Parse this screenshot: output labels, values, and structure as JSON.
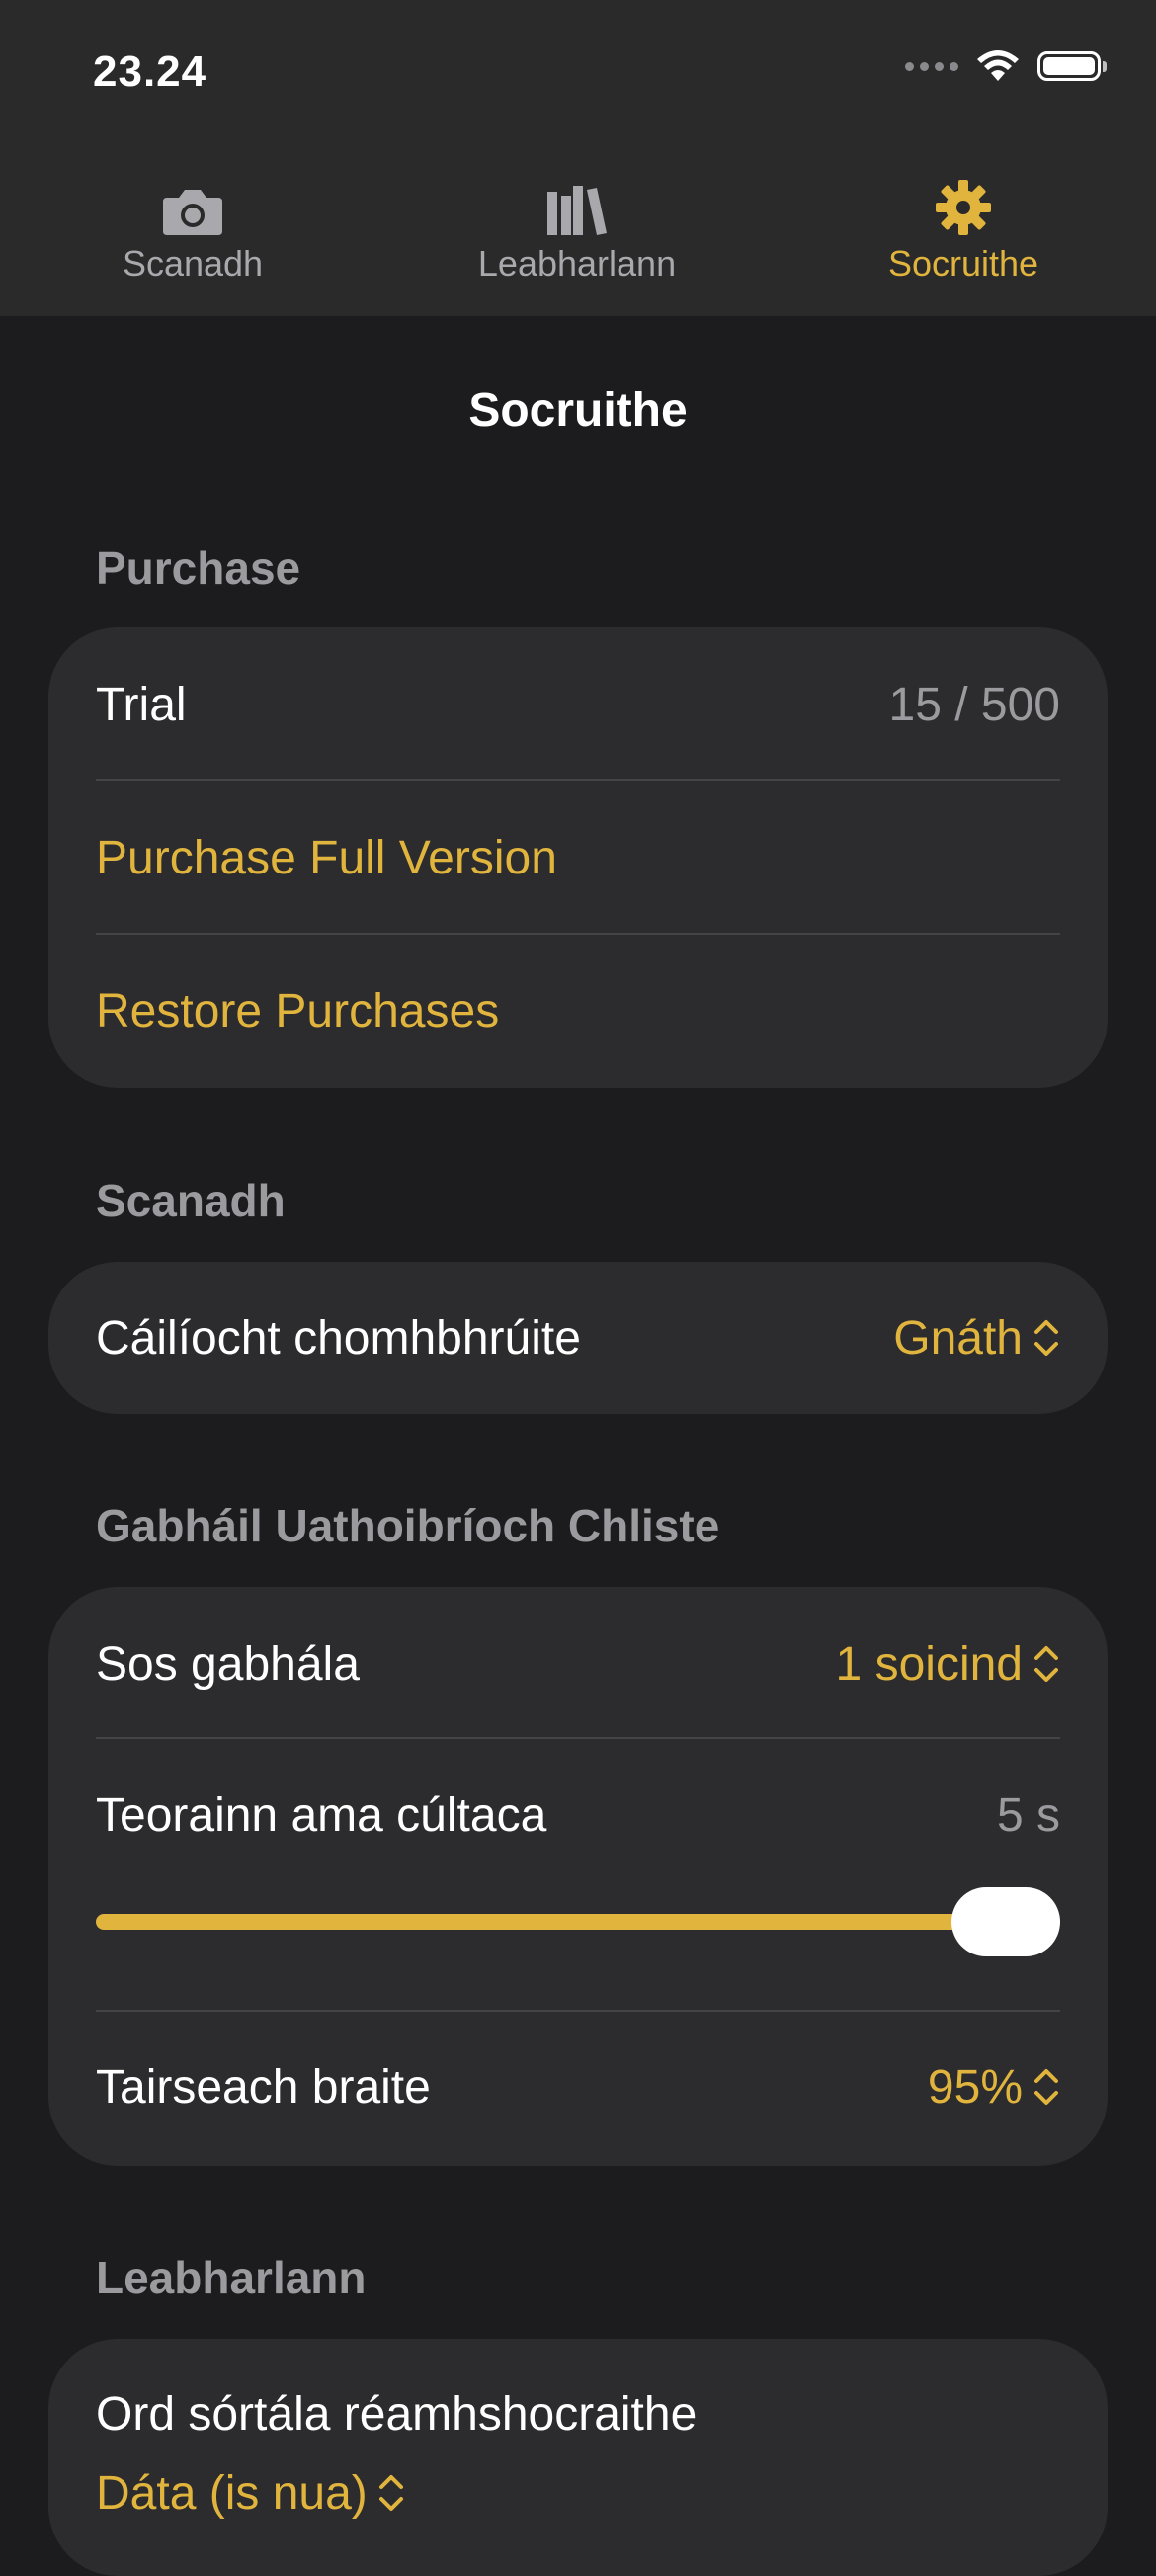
{
  "status_bar": {
    "time": "23.24"
  },
  "tabs": [
    {
      "label": "Scanadh",
      "icon": "camera-icon",
      "active": false
    },
    {
      "label": "Leabharlann",
      "icon": "library-icon",
      "active": false
    },
    {
      "label": "Socruithe",
      "icon": "gear-icon",
      "active": true
    }
  ],
  "page_title": "Socruithe",
  "purchase": {
    "header": "Purchase",
    "trial_label": "Trial",
    "trial_value": "15 / 500",
    "purchase_full": "Purchase Full Version",
    "restore": "Restore Purchases"
  },
  "scan": {
    "header": "Scanadh",
    "quality_label": "Cáilíocht chomhbhrúite",
    "quality_value": "Gnáth"
  },
  "smart_capture": {
    "header": "Gabháil Uathoibríoch Chliste",
    "pause_label": "Sos gabhála",
    "pause_value": "1 soicind",
    "timeout_label": "Teorainn ama cúltaca",
    "timeout_value": "5 s",
    "timeout_slider_fraction": 1.0,
    "threshold_label": "Tairseach braite",
    "threshold_value": "95%"
  },
  "library": {
    "header": "Leabharlann",
    "sort_label": "Ord sórtála réamhshocraithe",
    "sort_value": "Dáta (is nua)"
  },
  "colors": {
    "accent": "#e0b43d",
    "background": "#1c1c1e",
    "card": "#2c2c2e",
    "secondary_text": "#9a9a9f"
  }
}
